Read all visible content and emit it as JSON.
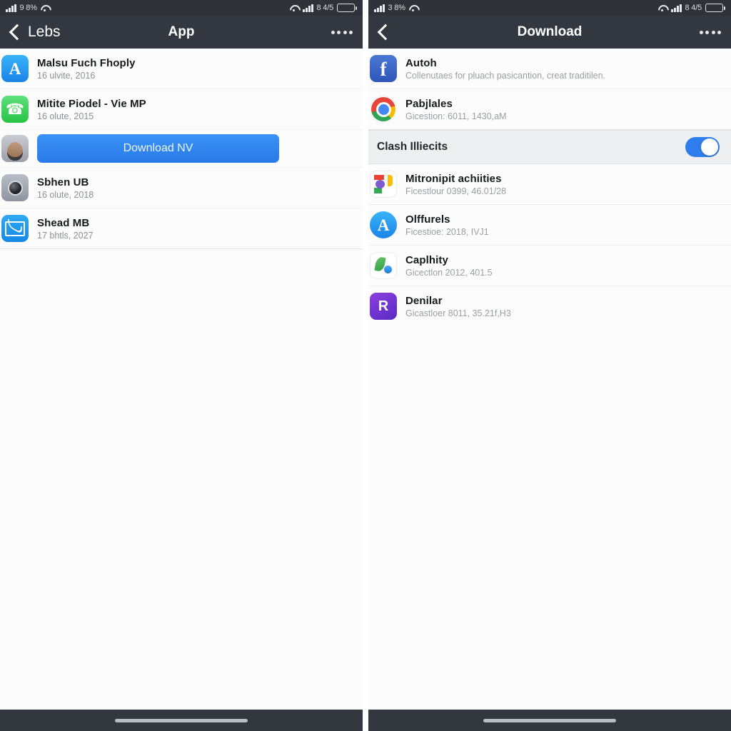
{
  "left_panel": {
    "statusbar": {
      "left_text": "9 8%",
      "right_text": "8 4/5"
    },
    "nav": {
      "back_label": "Lebs",
      "title": "App",
      "more_icon": "more-dots-icon"
    },
    "rows": [
      {
        "icon": "appstore-icon",
        "title": "Malsu Fuch Fhoply",
        "sub": "16 ulvite, 2016"
      },
      {
        "icon": "phone-icon",
        "title": "Mitite Piodel - Vie MP",
        "sub": "16 olute, 2015"
      },
      {
        "icon": "contact-photo-icon",
        "title": "",
        "sub": "",
        "button": "Download NV"
      },
      {
        "icon": "camera-icon",
        "title": "Sbhen UB",
        "sub": "16 olute, 2018"
      },
      {
        "icon": "mail-icon",
        "title": "Shead MB",
        "sub": "17 bhtls, 2027"
      }
    ]
  },
  "right_panel": {
    "statusbar": {
      "left_text": "3 8%",
      "right_text": "8 4/5"
    },
    "nav": {
      "back_label": "",
      "title": "Download",
      "more_icon": "more-dots-icon"
    },
    "top_rows": [
      {
        "icon": "facebook-icon",
        "title": "Autoh",
        "sub": "Collenutaes for pluach pasicantion, creat traditilen."
      },
      {
        "icon": "chrome-icon",
        "title": "Pabjlales",
        "sub": "Gicestion: 6011, 1430,aM"
      }
    ],
    "section": {
      "label": "Clash Illiecits",
      "toggle_on": true,
      "toggle_color": "#2f7ded"
    },
    "bottom_rows": [
      {
        "icon": "google-photos-icon",
        "title": "Mitronipit achiities",
        "sub": "Ficestlour 0399, 46.01/28"
      },
      {
        "icon": "appstore-icon",
        "title": "Olffurels",
        "sub": "Ficestioe: 2018,  IVJ1"
      },
      {
        "icon": "droplet-icon",
        "title": "Caplhity",
        "sub": "Gicectlon 2012, 401.5"
      },
      {
        "icon": "purple-r-icon",
        "title": "Denilar",
        "sub": "Gicastloer 8011, 35.21f,H3"
      }
    ]
  }
}
